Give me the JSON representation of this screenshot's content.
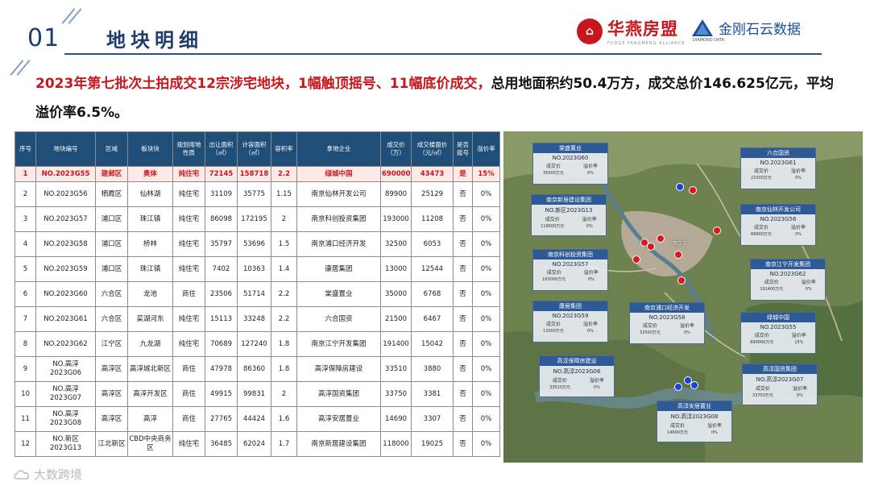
{
  "header": {
    "section_number": "01",
    "section_title": "地块明细",
    "logo1_name": "华燕房盟",
    "logo1_tagline": "FUDGE FANGMENG ALLIANCE",
    "logo1_icon": "house-circle-logo",
    "logo2_name": "金刚石云数据",
    "logo2_tagline": "DIAMOND DATA",
    "logo2_icon": "diamond-logo"
  },
  "summary": {
    "part1": "2023年第七批次土拍成交12宗涉宅地块，1幅触顶摇号、11幅底价成交，",
    "part2": "总用地面积约50.4万方，成交总价146.625亿元，平均溢价率6.5%。"
  },
  "table": {
    "headers": [
      "序号",
      "地块编号",
      "区域",
      "板块块",
      "规划用地性质",
      "出让面积（㎡）",
      "计容面积（㎡）",
      "容积率",
      "拿地企业",
      "成交价（万）",
      "成交楼面价（元/㎡）",
      "是否摇号",
      "溢价率"
    ],
    "rows": [
      [
        "1",
        "NO.2023G55",
        "建邺区",
        "奥体",
        "纯住宅",
        "72145",
        "158718",
        "2.2",
        "绿城中国",
        "690000",
        "43473",
        "是",
        "15%"
      ],
      [
        "2",
        "NO.2023G56",
        "栖霞区",
        "仙林湖",
        "纯住宅",
        "31109",
        "35775",
        "1.15",
        "南京仙林开发公司",
        "89900",
        "25129",
        "否",
        "0%"
      ],
      [
        "3",
        "NO.2023G57",
        "浦口区",
        "珠江镇",
        "纯住宅",
        "86098",
        "172195",
        "2",
        "南京科创投资集团",
        "193000",
        "11208",
        "否",
        "0%"
      ],
      [
        "4",
        "NO.2023G58",
        "浦口区",
        "桥林",
        "纯住宅",
        "35797",
        "53696",
        "1.5",
        "南京浦口经济开发",
        "32500",
        "6053",
        "否",
        "0%"
      ],
      [
        "5",
        "NO.2023G59",
        "浦口区",
        "珠江镇",
        "纯住宅",
        "7402",
        "10363",
        "1.4",
        "康居集团",
        "13000",
        "12544",
        "否",
        "0%"
      ],
      [
        "6",
        "NO.2023G60",
        "六合区",
        "龙池",
        "商住",
        "23506",
        "51714",
        "2.2",
        "棠盛置业",
        "35000",
        "6768",
        "否",
        "0%"
      ],
      [
        "7",
        "NO.2023G61",
        "六合区",
        "菜湖河东",
        "纯住宅",
        "15113",
        "33248",
        "2.2",
        "六合国资",
        "21500",
        "6467",
        "否",
        "0%"
      ],
      [
        "8",
        "NO.2023G62",
        "江宁区",
        "九龙湖",
        "纯住宅",
        "70689",
        "127240",
        "1.8",
        "南京江宁开发集团",
        "191400",
        "15042",
        "否",
        "0%"
      ],
      [
        "9",
        "NO.高淳2023G06",
        "高淳区",
        "高淳城北新区",
        "商住",
        "47978",
        "86360",
        "1.8",
        "高淳保障房建设",
        "33510",
        "3880",
        "否",
        "0%"
      ],
      [
        "10",
        "NO.高淳2023G07",
        "高淳区",
        "高淳开发区",
        "商住",
        "49915",
        "99831",
        "2",
        "高淳国资集团",
        "33750",
        "3381",
        "否",
        "0%"
      ],
      [
        "11",
        "NO.高淳2023G08",
        "高淳区",
        "高淳",
        "商住",
        "27765",
        "44424",
        "1.6",
        "高淳安居置业",
        "14690",
        "3307",
        "否",
        "0%"
      ],
      [
        "12",
        "NO.新区2023G13",
        "江北新区",
        "CBD中央商务区",
        "纯住宅",
        "36485",
        "62024",
        "1.7",
        "南京新居建设集团",
        "118000",
        "19025",
        "否",
        "0%"
      ]
    ]
  },
  "map": {
    "city_label": "南京市",
    "callouts": [
      {
        "company": "棠盛置业",
        "code": "NO.2023G60",
        "price_label": "成交价",
        "price": "35000万元",
        "premium_label": "溢价率",
        "premium": "0%"
      },
      {
        "company": "六合国资",
        "code": "NO.2023G61",
        "price_label": "成交价",
        "price": "21500万元",
        "premium_label": "溢价率",
        "premium": "0%"
      },
      {
        "company": "南京新居建设集团",
        "code": "NO.新区2023G13",
        "price_label": "成交价",
        "price": "118000万元",
        "premium_label": "溢价率",
        "premium": "0%"
      },
      {
        "company": "南京仙林开发公司",
        "code": "NO.2023G56",
        "price_label": "成交价",
        "price": "89900万元",
        "premium_label": "溢价率",
        "premium": "0%"
      },
      {
        "company": "南京科创投资集团",
        "code": "NO.2023G57",
        "price_label": "成交价",
        "price": "193000万元",
        "premium_label": "溢价率",
        "premium": "0%"
      },
      {
        "company": "南京江宁开发集团",
        "code": "NO.2023G62",
        "price_label": "成交价",
        "price": "191400万元",
        "premium_label": "溢价率",
        "premium": "0%"
      },
      {
        "company": "康居集团",
        "code": "NO.2023G59",
        "price_label": "成交价",
        "price": "13000万元",
        "premium_label": "溢价率",
        "premium": "0%"
      },
      {
        "company": "南京浦口经济开发",
        "code": "NO.2023G58",
        "price_label": "成交价",
        "price": "32500万元",
        "premium_label": "溢价率",
        "premium": "0%"
      },
      {
        "company": "绿城中国",
        "code": "NO.2023G55",
        "price_label": "成交价",
        "price": "690000万元",
        "premium_label": "溢价率",
        "premium": "15%"
      },
      {
        "company": "高淳保障房建设",
        "code": "NO.高淳2023G06",
        "price_label": "成交价",
        "price": "33510万元",
        "premium_label": "溢价率",
        "premium": "0%"
      },
      {
        "company": "高淳国资集团",
        "code": "NO.高淳2023G07",
        "price_label": "成交价",
        "price": "33750万元",
        "premium_label": "溢价率",
        "premium": "0%"
      },
      {
        "company": "高淳安居置业",
        "code": "NO.高淳2023G08",
        "price_label": "成交价",
        "price": "14690万元",
        "premium_label": "溢价率",
        "premium": "0%"
      }
    ]
  },
  "watermark": {
    "text": "大数跨境",
    "icon": "cloud-logo"
  },
  "colors": {
    "title_blue": "#1f3c6e",
    "accent_red": "#c8161d",
    "table_header": "#1f4e79",
    "callout_header": "#2d5a96"
  }
}
